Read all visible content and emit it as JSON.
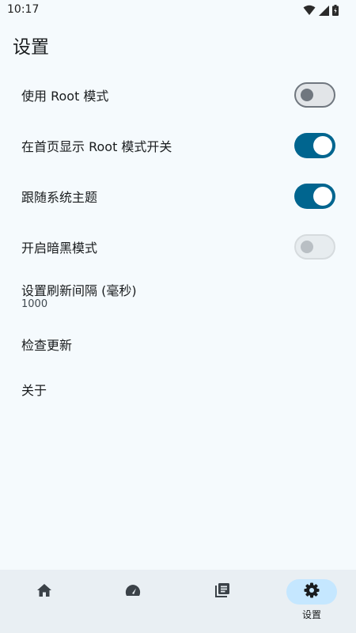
{
  "status_bar": {
    "time": "10:17",
    "icons": [
      "wifi-icon",
      "signal-icon",
      "battery-icon"
    ]
  },
  "page": {
    "title": "设置"
  },
  "settings": {
    "use_root": {
      "label": "使用 Root 模式",
      "state": "off"
    },
    "show_root_toggle_on_home": {
      "label": "在首页显示 Root 模式开关",
      "state": "on"
    },
    "follow_system_theme": {
      "label": "跟随系统主题",
      "state": "on"
    },
    "dark_mode": {
      "label": "开启暗黑模式",
      "state": "off-disabled"
    },
    "refresh_interval": {
      "label": "设置刷新间隔 (毫秒)",
      "value": "1000"
    },
    "check_update": {
      "label": "检查更新"
    },
    "about": {
      "label": "关于"
    }
  },
  "nav": {
    "items": [
      {
        "icon": "home-icon",
        "label": ""
      },
      {
        "icon": "speedometer-icon",
        "label": ""
      },
      {
        "icon": "library-icon",
        "label": ""
      },
      {
        "icon": "gear-icon",
        "label": "设置",
        "active": true
      }
    ]
  },
  "colors": {
    "accent": "#00658f",
    "background": "#f5fafd",
    "nav_background": "#e9eff3",
    "nav_active_pill": "#c5e7ff"
  }
}
